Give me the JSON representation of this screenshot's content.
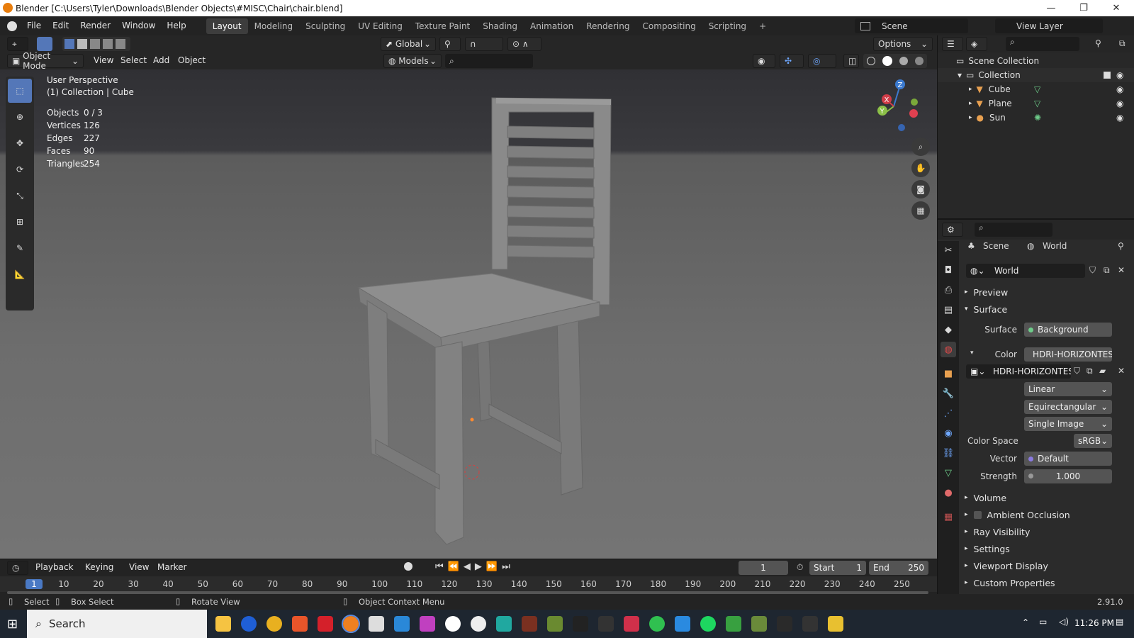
{
  "window": {
    "title": "Blender [C:\\Users\\Tyler\\Downloads\\Blender Objects\\#MISC\\Chair\\chair.blend]",
    "minimize": "—",
    "maximize": "❐",
    "close": "✕"
  },
  "menu": [
    "File",
    "Edit",
    "Render",
    "Window",
    "Help"
  ],
  "workspaces": [
    "Layout",
    "Modeling",
    "Sculpting",
    "UV Editing",
    "Texture Paint",
    "Shading",
    "Animation",
    "Rendering",
    "Compositing",
    "Scripting"
  ],
  "workspace_add": "+",
  "scene_field": "Scene",
  "view_layer_field": "View Layer",
  "viewport": {
    "mode": "Object Mode",
    "menus": [
      "View",
      "Select",
      "Add",
      "Object"
    ],
    "transform_orientation": "Global",
    "collection_filter": "Models",
    "options": "Options",
    "perspective": "User Perspective",
    "context": "(1) Collection | Cube",
    "stats": [
      {
        "label": "Objects",
        "value": "0 / 3"
      },
      {
        "label": "Vertices",
        "value": "126"
      },
      {
        "label": "Edges",
        "value": "227"
      },
      {
        "label": "Faces",
        "value": "90"
      },
      {
        "label": "Triangles",
        "value": "254"
      }
    ],
    "gizmo": {
      "z": "Z",
      "x": "X",
      "y": "Y"
    }
  },
  "outliner": {
    "root": "Scene Collection",
    "collection": "Collection",
    "items": [
      "Cube",
      "Plane",
      "Sun"
    ]
  },
  "properties": {
    "breadcrumb_scene": "Scene",
    "breadcrumb_world": "World",
    "world_name": "World",
    "panels": {
      "preview": "Preview",
      "surface": "Surface",
      "volume": "Volume",
      "ambient_occlusion": "Ambient Occlusion",
      "ray_visibility": "Ray Visibility",
      "settings": "Settings",
      "viewport_display": "Viewport Display",
      "custom_properties": "Custom Properties"
    },
    "surface_label": "Surface",
    "surface_value": "Background",
    "color_label": "Color",
    "color_value": "HDRI-HORIZONTES-...",
    "image_name": "HDRI-HORIZONTES-...",
    "interpolation": "Linear",
    "projection": "Equirectangular",
    "source": "Single Image",
    "color_space_label": "Color Space",
    "color_space_value": "sRGB",
    "vector_label": "Vector",
    "vector_value": "Default",
    "strength_label": "Strength",
    "strength_value": "1.000"
  },
  "timeline": {
    "menus": [
      "Playback",
      "Keying",
      "View",
      "Marker"
    ],
    "current_frame": "1",
    "start_label": "Start",
    "start_value": "1",
    "end_label": "End",
    "end_value": "250",
    "ruler": [
      "1",
      "10",
      "20",
      "30",
      "40",
      "50",
      "60",
      "70",
      "80",
      "90",
      "100",
      "110",
      "120",
      "130",
      "140",
      "150",
      "160",
      "170",
      "180",
      "190",
      "200",
      "210",
      "220",
      "230",
      "240",
      "250"
    ]
  },
  "status": {
    "select": "Select",
    "box_select": "Box Select",
    "rotate_view": "Rotate View",
    "context_menu": "Object Context Menu",
    "version": "2.91.0"
  },
  "taskbar": {
    "search": "Search",
    "time": "11:26 PM"
  },
  "colors": {
    "accent": "#5477b8",
    "active_tab": "#3d3d3d",
    "frame_marker": "#4a79c4"
  }
}
